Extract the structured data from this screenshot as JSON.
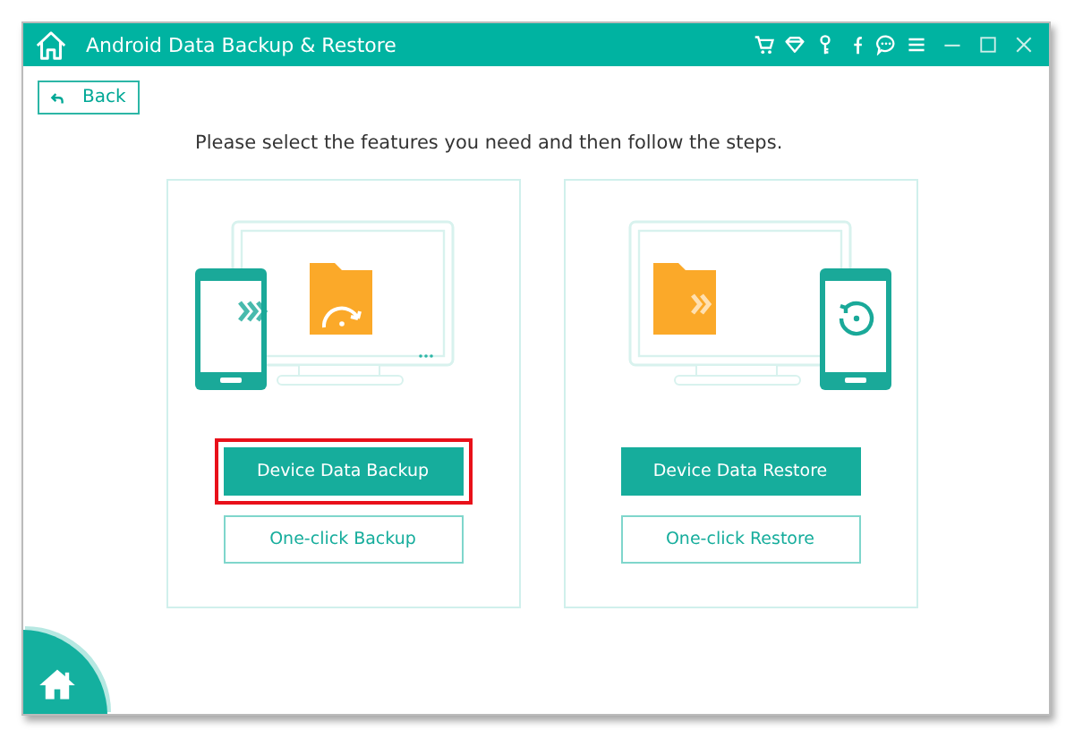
{
  "window": {
    "title": "Android Data Backup & Restore"
  },
  "back_button": {
    "label": "Back"
  },
  "instruction": "Please select the features you need and then follow the steps.",
  "options": [
    {
      "kind": "backup",
      "primary": "Device Data Backup",
      "secondary": "One-click Backup",
      "highlighted": true
    },
    {
      "kind": "restore",
      "primary": "Device Data Restore",
      "secondary": "One-click Restore",
      "highlighted": false
    }
  ]
}
